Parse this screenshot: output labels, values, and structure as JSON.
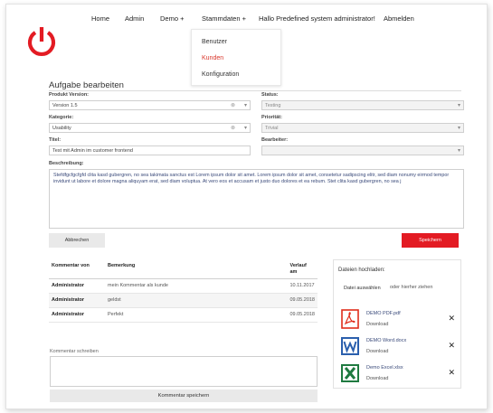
{
  "nav": {
    "home": "Home",
    "admin": "Admin",
    "demo": "Demo +",
    "stammdaten": "Stammdaten +",
    "greeting": "Hallo Predefined system administrator!",
    "logout": "Abmelden"
  },
  "dropdown": {
    "items": [
      "Benutzer",
      "Kunden",
      "Konfiguration"
    ]
  },
  "page_title": "Aufgabe bearbeiten",
  "form": {
    "produkt_label": "Produkt Version:",
    "produkt_value": "Version 1.5",
    "status_label": "Status:",
    "status_value": "Testing",
    "kategorie_label": "Kategorie:",
    "kategorie_value": "Usability",
    "prioritaet_label": "Priorität:",
    "prioritaet_value": "Trivial",
    "titel_label": "Titel:",
    "titel_value": "Test mit Admin im customer frontend",
    "bearbeiter_label": "Bearbeiter:",
    "bearbeiter_value": "",
    "beschreibung_label": "Beschreibung:",
    "beschreibung_value": "Stefdfgcfgcfgfd clita kasd gubergren, no sea takimata sanctus est Lorem ipsum dolor sit amet. Lorem ipsum dolor sit amet, consetetur sadipscing elitr, sed diam nonumy eirmod tempor invidunt ut labore et dolore magna aliquyam erat, sed diam voluptua. At vero eos et accusam et justo duo dolores et ea rebum. Stet clita kasd gubergren, no sea j"
  },
  "buttons": {
    "abbrechen": "Abbrechen",
    "speichern": "Speichern",
    "kommentar_speichern": "Kommentar speichern"
  },
  "comments": {
    "headers": [
      "Kommentar von",
      "Bemerkung",
      "Verlauf am"
    ],
    "rows": [
      {
        "author": "Administrator",
        "text": "mein Kommentar als kunde",
        "date": "10.11.2017"
      },
      {
        "author": "Administrator",
        "text": "geldst",
        "date": "09.05.2018"
      },
      {
        "author": "Administrator",
        "text": "Perfekt",
        "date": "09.05.2018"
      }
    ],
    "write_label": "Kommentar schreiben"
  },
  "upload": {
    "title": "Dateien hochladen:",
    "choose": "Datei auswählen",
    "or_drag": "oder hierher ziehen",
    "download_label": "Download",
    "files": [
      {
        "name": "DEMO PDF.pdf",
        "icon": "pdf-icon",
        "color": "#e02d1b"
      },
      {
        "name": "DEMO Word.docx",
        "icon": "word-icon",
        "color": "#2b5fad"
      },
      {
        "name": "Demo Excel.xlsx",
        "icon": "excel-icon",
        "color": "#1f7a40"
      }
    ]
  },
  "colors": {
    "brand_red": "#e31b23",
    "link_blue": "#3a4a7a"
  }
}
